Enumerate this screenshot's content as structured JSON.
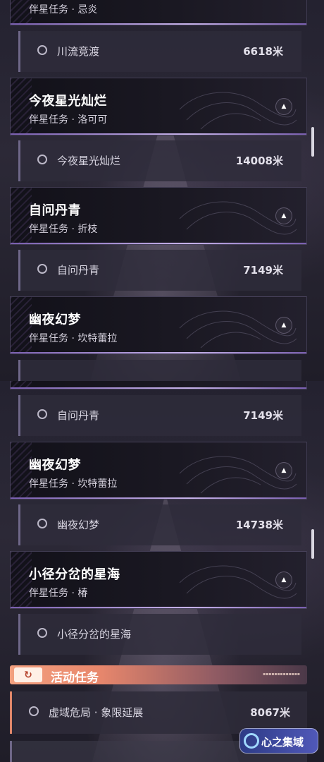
{
  "top_panel": {
    "clipped_card_subtitle": "伴星任务 · 忌炎",
    "tasks": [
      {
        "name": "川流竞渡",
        "distance": "6618米"
      },
      {
        "name": "今夜星光灿烂",
        "distance": "14008米"
      },
      {
        "name": "自问丹青",
        "distance": "7149米"
      }
    ],
    "cards": [
      {
        "title": "今夜星光灿烂",
        "subtitle": "伴星任务 · 洛可可"
      },
      {
        "title": "自问丹青",
        "subtitle": "伴星任务 · 折枝"
      },
      {
        "title": "幽夜幻梦",
        "subtitle": "伴星任务 · 坎特蕾拉"
      }
    ]
  },
  "bottom_panel": {
    "tasks": [
      {
        "name": "自问丹青",
        "distance": "7149米"
      },
      {
        "name": "幽夜幻梦",
        "distance": "14738米"
      },
      {
        "name": "小径分岔的星海",
        "distance": ""
      }
    ],
    "cards": [
      {
        "title": "幽夜幻梦",
        "subtitle": "伴星任务 · 坎特蕾拉"
      },
      {
        "title": "小径分岔的星海",
        "subtitle": "伴星任务 · 椿"
      }
    ],
    "activity_section": {
      "title": "活动任务",
      "icon": "refresh-icon",
      "accent_color": "#f3a07f",
      "task": {
        "name": "虚域危局 · 象限延展",
        "distance": "8067米"
      }
    },
    "watermark": {
      "text": "心之集域"
    }
  },
  "icons": {
    "collapse": "chevron-up-icon",
    "task_status": "circle-outline-icon"
  },
  "colors": {
    "card_underline": "#c7b3ea",
    "activity_accent": "#e0876a",
    "background": "#1b1a24"
  }
}
